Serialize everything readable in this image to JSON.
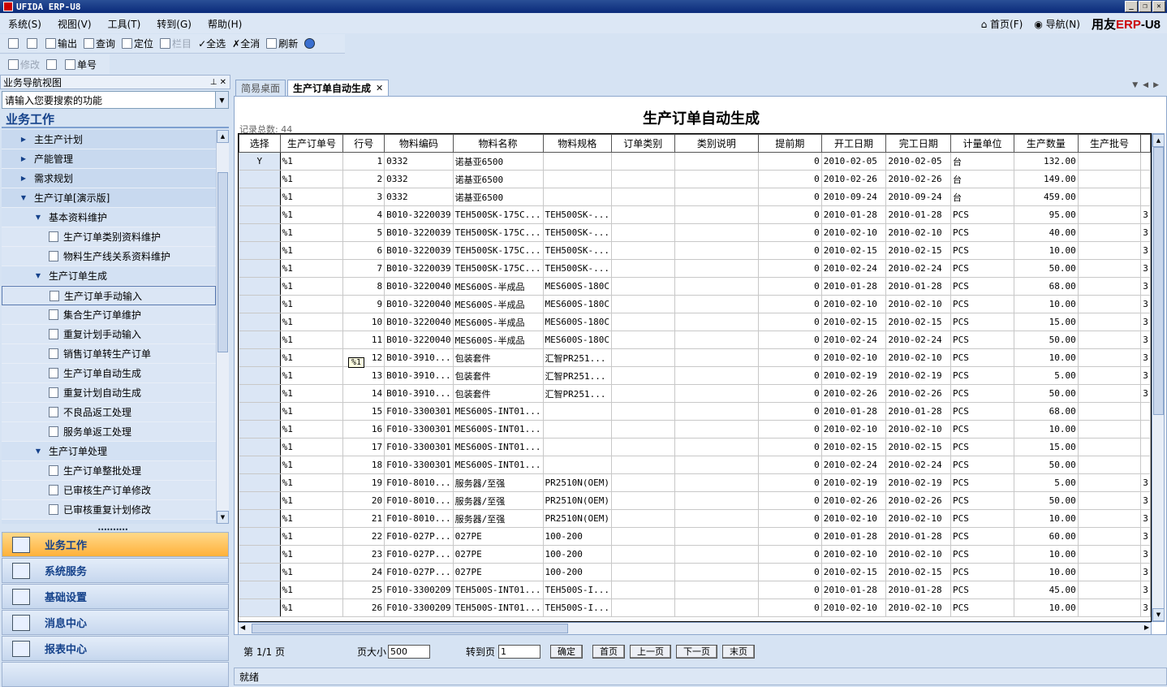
{
  "app_title": "UFIDA ERP-U8",
  "menu": [
    "系统(S)",
    "视图(V)",
    "工具(T)",
    "转到(G)",
    "帮助(H)"
  ],
  "right_menu": {
    "home": "首页(F)",
    "nav": "导航(N)",
    "brand_a": "用友",
    "brand_b": "ERP",
    "brand_c": "-U8"
  },
  "toolbar": {
    "output": "输出",
    "query": "查询",
    "locate": "定位",
    "column": "栏目",
    "select_all": "全选",
    "deselect_all": "全消",
    "refresh": "刷新"
  },
  "toolbar2": {
    "modify": "修改",
    "order_no": "单号"
  },
  "left": {
    "header": "业务导航视图",
    "search_placeholder": "请输入您要搜索的功能",
    "section": "业务工作",
    "tree": [
      {
        "label": "主生产计划",
        "level": 1,
        "type": "collapsed"
      },
      {
        "label": "产能管理",
        "level": 1,
        "type": "collapsed"
      },
      {
        "label": "需求规划",
        "level": 1,
        "type": "collapsed"
      },
      {
        "label": "生产订单[演示版]",
        "level": 1,
        "type": "expanded"
      },
      {
        "label": "基本资料维护",
        "level": 2,
        "type": "expanded"
      },
      {
        "label": "生产订单类别资料维护",
        "level": 3,
        "type": "leaf"
      },
      {
        "label": "物料生产线关系资料维护",
        "level": 3,
        "type": "leaf"
      },
      {
        "label": "生产订单生成",
        "level": 2,
        "type": "expanded"
      },
      {
        "label": "生产订单手动输入",
        "level": 3,
        "type": "leaf-selected"
      },
      {
        "label": "集合生产订单维护",
        "level": 3,
        "type": "leaf"
      },
      {
        "label": "重复计划手动输入",
        "level": 3,
        "type": "leaf"
      },
      {
        "label": "销售订单转生产订单",
        "level": 3,
        "type": "leaf"
      },
      {
        "label": "生产订单自动生成",
        "level": 3,
        "type": "leaf"
      },
      {
        "label": "重复计划自动生成",
        "level": 3,
        "type": "leaf"
      },
      {
        "label": "不良品返工处理",
        "level": 3,
        "type": "leaf"
      },
      {
        "label": "服务单返工处理",
        "level": 3,
        "type": "leaf"
      },
      {
        "label": "生产订单处理",
        "level": 2,
        "type": "expanded"
      },
      {
        "label": "生产订单整批处理",
        "level": 3,
        "type": "leaf"
      },
      {
        "label": "已审核生产订单修改",
        "level": 3,
        "type": "leaf"
      },
      {
        "label": "已审核重复计划修改",
        "level": 3,
        "type": "leaf"
      }
    ],
    "nav_buttons": [
      "业务工作",
      "系统服务",
      "基础设置",
      "消息中心",
      "报表中心"
    ]
  },
  "tabs": [
    {
      "label": "简易桌面"
    },
    {
      "label": "生产订单自动生成",
      "close": "✕"
    }
  ],
  "page": {
    "title": "生产订单自动生成",
    "record_count": "记录总数: 44",
    "tooltip": "%1"
  },
  "grid": {
    "columns": [
      "选择",
      "生产订单号",
      "行号",
      "物料编码",
      "物料名称",
      "物料规格",
      "订单类别",
      "类别说明",
      "提前期",
      "开工日期",
      "完工日期",
      "计量单位",
      "生产数量",
      "生产批号"
    ],
    "rows": [
      [
        "Y",
        "%1",
        "1",
        "0332",
        "诺基亚6500",
        "",
        "",
        "",
        "0",
        "2010-02-05",
        "2010-02-05",
        "台",
        "132.00",
        ""
      ],
      [
        "",
        "%1",
        "2",
        "0332",
        "诺基亚6500",
        "",
        "",
        "",
        "0",
        "2010-02-26",
        "2010-02-26",
        "台",
        "149.00",
        ""
      ],
      [
        "",
        "%1",
        "3",
        "0332",
        "诺基亚6500",
        "",
        "",
        "",
        "0",
        "2010-09-24",
        "2010-09-24",
        "台",
        "459.00",
        ""
      ],
      [
        "",
        "%1",
        "4",
        "B010-3220039",
        "TEH500SK-175C...",
        "TEH500SK-...",
        "",
        "",
        "0",
        "2010-01-28",
        "2010-01-28",
        "PCS",
        "95.00",
        "3"
      ],
      [
        "",
        "%1",
        "5",
        "B010-3220039",
        "TEH500SK-175C...",
        "TEH500SK-...",
        "",
        "",
        "0",
        "2010-02-10",
        "2010-02-10",
        "PCS",
        "40.00",
        "3"
      ],
      [
        "",
        "%1",
        "6",
        "B010-3220039",
        "TEH500SK-175C...",
        "TEH500SK-...",
        "",
        "",
        "0",
        "2010-02-15",
        "2010-02-15",
        "PCS",
        "10.00",
        "3"
      ],
      [
        "",
        "%1",
        "7",
        "B010-3220039",
        "TEH500SK-175C...",
        "TEH500SK-...",
        "",
        "",
        "0",
        "2010-02-24",
        "2010-02-24",
        "PCS",
        "50.00",
        "3"
      ],
      [
        "",
        "%1",
        "8",
        "B010-3220040",
        "MES600S-半成品",
        "MES600S-180C",
        "",
        "",
        "0",
        "2010-01-28",
        "2010-01-28",
        "PCS",
        "68.00",
        "3"
      ],
      [
        "",
        "%1",
        "9",
        "B010-3220040",
        "MES600S-半成品",
        "MES600S-180C",
        "",
        "",
        "0",
        "2010-02-10",
        "2010-02-10",
        "PCS",
        "10.00",
        "3"
      ],
      [
        "",
        "%1",
        "10",
        "B010-3220040",
        "MES600S-半成品",
        "MES600S-180C",
        "",
        "",
        "0",
        "2010-02-15",
        "2010-02-15",
        "PCS",
        "15.00",
        "3"
      ],
      [
        "",
        "%1",
        "11",
        "B010-3220040",
        "MES600S-半成品",
        "MES600S-180C",
        "",
        "",
        "0",
        "2010-02-24",
        "2010-02-24",
        "PCS",
        "50.00",
        "3"
      ],
      [
        "",
        "%1",
        "12",
        "B010-3910...",
        "包装套件",
        "汇智PR251...",
        "",
        "",
        "0",
        "2010-02-10",
        "2010-02-10",
        "PCS",
        "10.00",
        "3"
      ],
      [
        "",
        "%1",
        "13",
        "B010-3910...",
        "包装套件",
        "汇智PR251...",
        "",
        "",
        "0",
        "2010-02-19",
        "2010-02-19",
        "PCS",
        "5.00",
        "3"
      ],
      [
        "",
        "%1",
        "14",
        "B010-3910...",
        "包装套件",
        "汇智PR251...",
        "",
        "",
        "0",
        "2010-02-26",
        "2010-02-26",
        "PCS",
        "50.00",
        "3"
      ],
      [
        "",
        "%1",
        "15",
        "F010-3300301",
        "MES600S-INT01...",
        "",
        "",
        "",
        "0",
        "2010-01-28",
        "2010-01-28",
        "PCS",
        "68.00",
        ""
      ],
      [
        "",
        "%1",
        "16",
        "F010-3300301",
        "MES600S-INT01...",
        "",
        "",
        "",
        "0",
        "2010-02-10",
        "2010-02-10",
        "PCS",
        "10.00",
        ""
      ],
      [
        "",
        "%1",
        "17",
        "F010-3300301",
        "MES600S-INT01...",
        "",
        "",
        "",
        "0",
        "2010-02-15",
        "2010-02-15",
        "PCS",
        "15.00",
        ""
      ],
      [
        "",
        "%1",
        "18",
        "F010-3300301",
        "MES600S-INT01...",
        "",
        "",
        "",
        "0",
        "2010-02-24",
        "2010-02-24",
        "PCS",
        "50.00",
        ""
      ],
      [
        "",
        "%1",
        "19",
        "F010-8010...",
        "服务器/至强",
        "PR2510N(OEM)",
        "",
        "",
        "0",
        "2010-02-19",
        "2010-02-19",
        "PCS",
        "5.00",
        "3"
      ],
      [
        "",
        "%1",
        "20",
        "F010-8010...",
        "服务器/至强",
        "PR2510N(OEM)",
        "",
        "",
        "0",
        "2010-02-26",
        "2010-02-26",
        "PCS",
        "50.00",
        "3"
      ],
      [
        "",
        "%1",
        "21",
        "F010-8010...",
        "服务器/至强",
        "PR2510N(OEM)",
        "",
        "",
        "0",
        "2010-02-10",
        "2010-02-10",
        "PCS",
        "10.00",
        "3"
      ],
      [
        "",
        "%1",
        "22",
        "F010-027P...",
        "027PE",
        "100-200",
        "",
        "",
        "0",
        "2010-01-28",
        "2010-01-28",
        "PCS",
        "60.00",
        "3"
      ],
      [
        "",
        "%1",
        "23",
        "F010-027P...",
        "027PE",
        "100-200",
        "",
        "",
        "0",
        "2010-02-10",
        "2010-02-10",
        "PCS",
        "10.00",
        "3"
      ],
      [
        "",
        "%1",
        "24",
        "F010-027P...",
        "027PE",
        "100-200",
        "",
        "",
        "0",
        "2010-02-15",
        "2010-02-15",
        "PCS",
        "10.00",
        "3"
      ],
      [
        "",
        "%1",
        "25",
        "F010-3300209",
        "TEH500S-INT01...",
        "TEH500S-I...",
        "",
        "",
        "0",
        "2010-01-28",
        "2010-01-28",
        "PCS",
        "45.00",
        "3"
      ],
      [
        "",
        "%1",
        "26",
        "F010-3300209",
        "TEH500S-INT01...",
        "TEH500S-I...",
        "",
        "",
        "0",
        "2010-02-10",
        "2010-02-10",
        "PCS",
        "10.00",
        "3"
      ]
    ]
  },
  "pager": {
    "page_info": "第 1/1 页",
    "page_size_label": "页大小",
    "page_size": "500",
    "goto_label": "转到页",
    "goto_value": "1",
    "confirm": "确定",
    "first": "首页",
    "prev": "上一页",
    "next": "下一页",
    "last": "末页"
  },
  "status": "就绪"
}
